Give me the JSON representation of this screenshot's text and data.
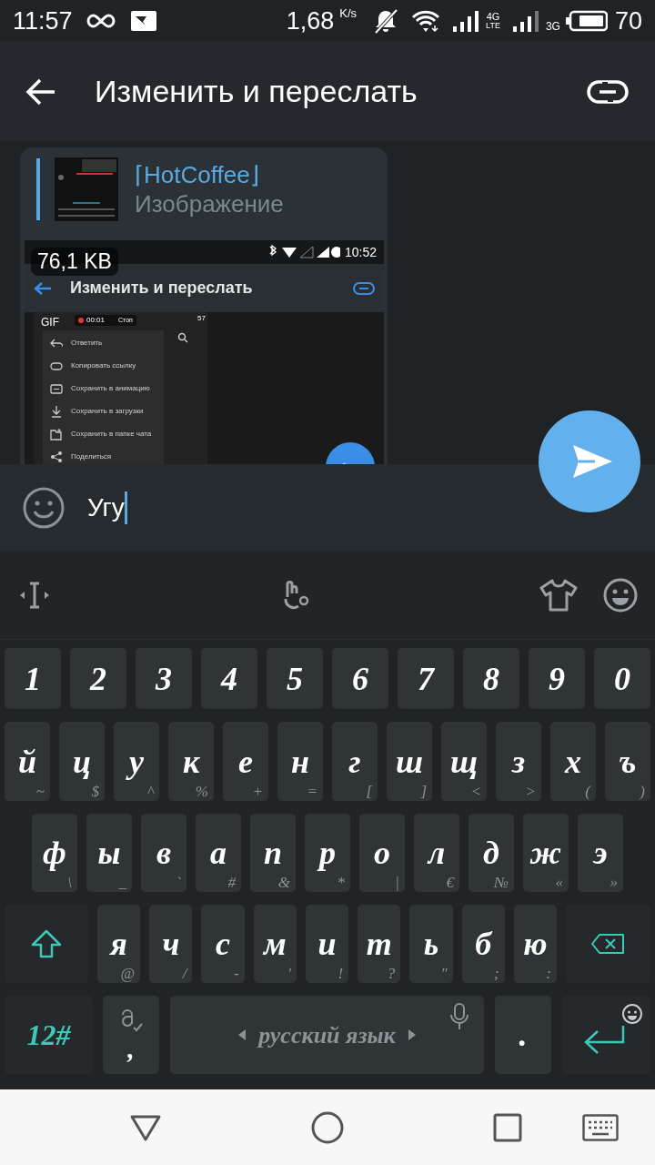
{
  "status_bar": {
    "time": "11:57",
    "speed": "1,68",
    "speed_unit": "K/s",
    "network_a": "4G",
    "network_a_sub": "LTE",
    "network_b": "3G",
    "battery": "70"
  },
  "header": {
    "title": "Изменить и переслать"
  },
  "message": {
    "sender": "⌈HotCoffee⌋",
    "type_label": "Изображение",
    "file_size": "76,1 KB",
    "preview": {
      "time": "10:52",
      "title": "Изменить и переслать",
      "gif": "GIF",
      "recording_time": "00:01",
      "stop": "Стоп",
      "battery": "57",
      "menu": [
        {
          "kind": "reply",
          "label": "Ответить"
        },
        {
          "kind": "link",
          "label": "Копировать ссылку"
        },
        {
          "kind": "gif",
          "label": "Сохранить в анимацию"
        },
        {
          "kind": "download",
          "label": "Сохранить в загрузки"
        },
        {
          "kind": "folder",
          "label": "Сохранить в папке чата"
        },
        {
          "kind": "share",
          "label": "Поделиться"
        }
      ]
    }
  },
  "composer": {
    "value": "Угу"
  },
  "keyboard": {
    "rows": [
      {
        "keys": [
          {
            "kind": "char",
            "label": "1"
          },
          {
            "kind": "char",
            "label": "2"
          },
          {
            "kind": "char",
            "label": "3"
          },
          {
            "kind": "char",
            "label": "4"
          },
          {
            "kind": "char",
            "label": "5"
          },
          {
            "kind": "char",
            "label": "6"
          },
          {
            "kind": "char",
            "label": "7"
          },
          {
            "kind": "char",
            "label": "8"
          },
          {
            "kind": "char",
            "label": "9"
          },
          {
            "kind": "char",
            "label": "0"
          }
        ]
      },
      {
        "keys": [
          {
            "kind": "char",
            "label": "й",
            "hint": "~"
          },
          {
            "kind": "char",
            "label": "ц",
            "hint": "$"
          },
          {
            "kind": "char",
            "label": "у",
            "hint": "^"
          },
          {
            "kind": "char",
            "label": "к",
            "hint": "%"
          },
          {
            "kind": "char",
            "label": "е",
            "hint": "+"
          },
          {
            "kind": "char",
            "label": "н",
            "hint": "="
          },
          {
            "kind": "char",
            "label": "г",
            "hint": "["
          },
          {
            "kind": "char",
            "label": "ш",
            "hint": "]"
          },
          {
            "kind": "char",
            "label": "щ",
            "hint": "<"
          },
          {
            "kind": "char",
            "label": "з",
            "hint": ">"
          },
          {
            "kind": "char",
            "label": "х",
            "hint": "("
          },
          {
            "kind": "char",
            "label": "ъ",
            "hint": ")"
          }
        ]
      },
      {
        "keys": [
          {
            "kind": "char",
            "label": "ф",
            "hint": "\\"
          },
          {
            "kind": "char",
            "label": "ы",
            "hint": "_"
          },
          {
            "kind": "char",
            "label": "в",
            "hint": "`"
          },
          {
            "kind": "char",
            "label": "а",
            "hint": "#"
          },
          {
            "kind": "char",
            "label": "п",
            "hint": "&"
          },
          {
            "kind": "char",
            "label": "р",
            "hint": "*"
          },
          {
            "kind": "char",
            "label": "о",
            "hint": "|"
          },
          {
            "kind": "char",
            "label": "л",
            "hint": "€"
          },
          {
            "kind": "char",
            "label": "д",
            "hint": "№"
          },
          {
            "kind": "char",
            "label": "ж",
            "hint": "«"
          },
          {
            "kind": "char",
            "label": "э",
            "hint": "»"
          }
        ]
      },
      {
        "keys": [
          {
            "kind": "shift"
          },
          {
            "kind": "char",
            "label": "я",
            "hint": "@"
          },
          {
            "kind": "char",
            "label": "ч",
            "hint": "/"
          },
          {
            "kind": "char",
            "label": "с",
            "hint": "-"
          },
          {
            "kind": "char",
            "label": "м",
            "hint": "′"
          },
          {
            "kind": "char",
            "label": "и",
            "hint": "!"
          },
          {
            "kind": "char",
            "label": "т",
            "hint": "?"
          },
          {
            "kind": "char",
            "label": "ь",
            "hint": "″"
          },
          {
            "kind": "char",
            "label": "б",
            "hint": ";"
          },
          {
            "kind": "char",
            "label": "ю",
            "hint": ":"
          },
          {
            "kind": "backspace"
          }
        ]
      },
      {
        "keys": [
          {
            "kind": "symbols",
            "label": "12#"
          },
          {
            "kind": "comma",
            "label": ","
          },
          {
            "kind": "space",
            "label": "русский язык"
          },
          {
            "kind": "period",
            "label": "."
          },
          {
            "kind": "enter"
          }
        ]
      }
    ]
  }
}
